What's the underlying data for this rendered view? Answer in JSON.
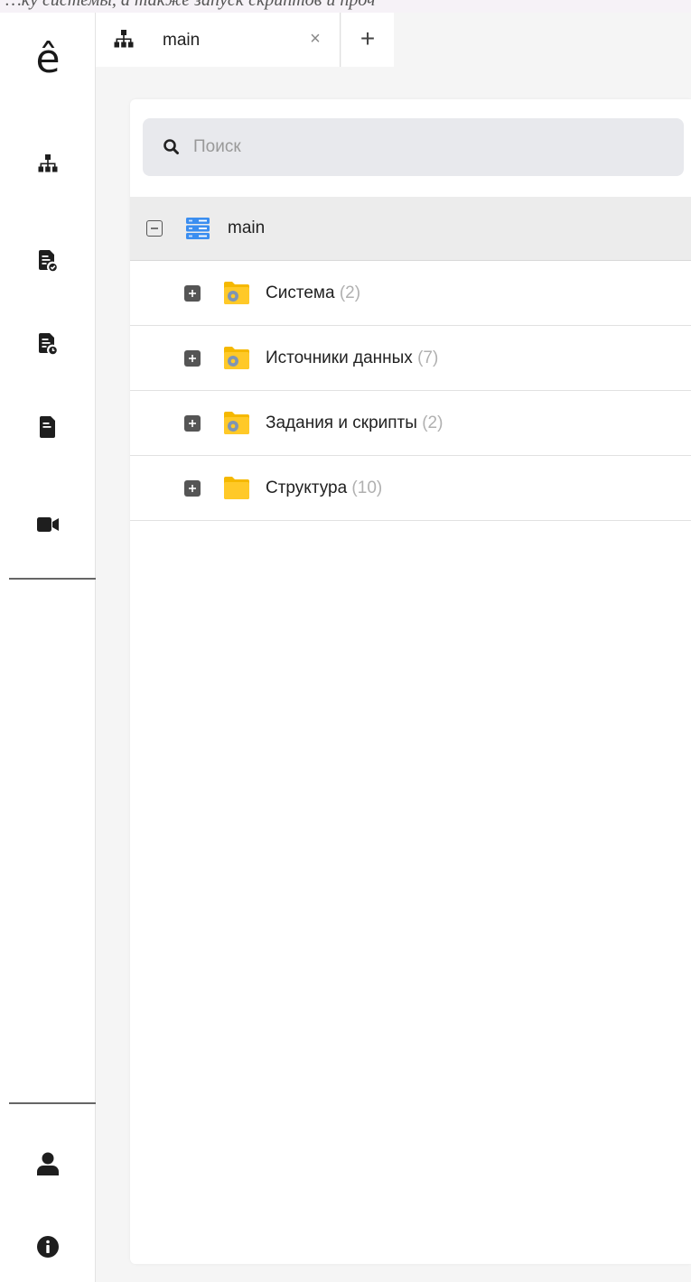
{
  "header_strip": {
    "text": "…ку системы, а также запуск скриптов и проч"
  },
  "sidebar": {
    "logo": "ê",
    "items": [
      {
        "name": "structure",
        "icon": "sitemap-icon"
      },
      {
        "name": "docs-check",
        "icon": "file-check-icon"
      },
      {
        "name": "docs-clock",
        "icon": "file-clock-icon"
      },
      {
        "name": "docs",
        "icon": "file-icon"
      },
      {
        "name": "video",
        "icon": "video-camera-icon"
      }
    ],
    "bottom_items": [
      {
        "name": "user",
        "icon": "user-icon"
      },
      {
        "name": "info",
        "icon": "info-icon"
      }
    ]
  },
  "tabs": {
    "active": {
      "label": "main",
      "icon": "sitemap-icon",
      "close": "×"
    },
    "add": "+"
  },
  "search": {
    "placeholder": "Поиск",
    "value": ""
  },
  "tree": {
    "root": {
      "label": "main",
      "icon": "database-icon",
      "expanded": true
    },
    "children": [
      {
        "label": "Система",
        "count": "(2)",
        "icon": "folder-gear-icon"
      },
      {
        "label": "Источники данных",
        "count": "(7)",
        "icon": "folder-gear-icon"
      },
      {
        "label": "Задания и скрипты",
        "count": "(2)",
        "icon": "folder-gear-icon"
      },
      {
        "label": "Структура",
        "count": "(10)",
        "icon": "folder-icon"
      }
    ]
  },
  "colors": {
    "folder": "#f5b800",
    "gear": "#7f95b5",
    "database": "#3b8ef0",
    "sidebar_icon": "#1e1e1e",
    "count_text": "#b0b0b0"
  }
}
